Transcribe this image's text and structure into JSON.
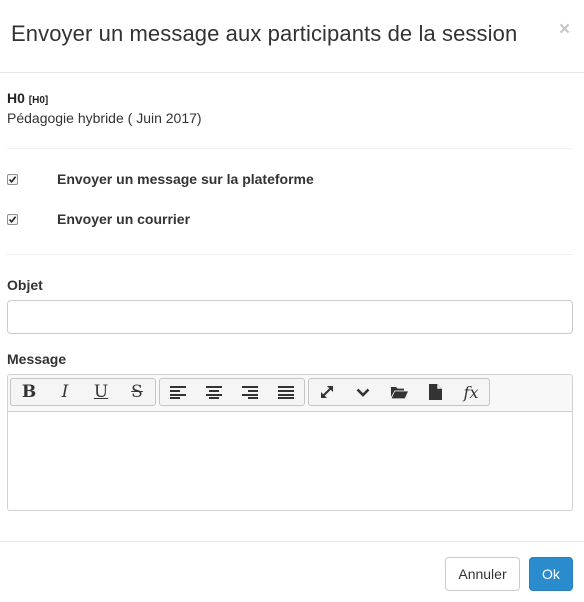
{
  "modal": {
    "title": "Envoyer un message aux participants de la session",
    "close_symbol": "×"
  },
  "session": {
    "code": "H0",
    "code_tag": "[H0]",
    "name": "Pédagogie hybride ( Juin 2017)"
  },
  "options": [
    {
      "label": "Envoyer un message sur la plateforme",
      "checked": true
    },
    {
      "label": "Envoyer un courrier",
      "checked": true
    }
  ],
  "form": {
    "subject_label": "Objet",
    "subject_value": "",
    "message_label": "Message",
    "message_value": ""
  },
  "toolbar": {
    "bold": "B",
    "italic": "I",
    "underline": "U",
    "strike": "S",
    "formula": "fx"
  },
  "footer": {
    "cancel_label": "Annuler",
    "ok_label": "Ok"
  },
  "colors": {
    "primary": "#2b8ccd",
    "close": "#c8c8c8",
    "border": "#cccccc"
  }
}
